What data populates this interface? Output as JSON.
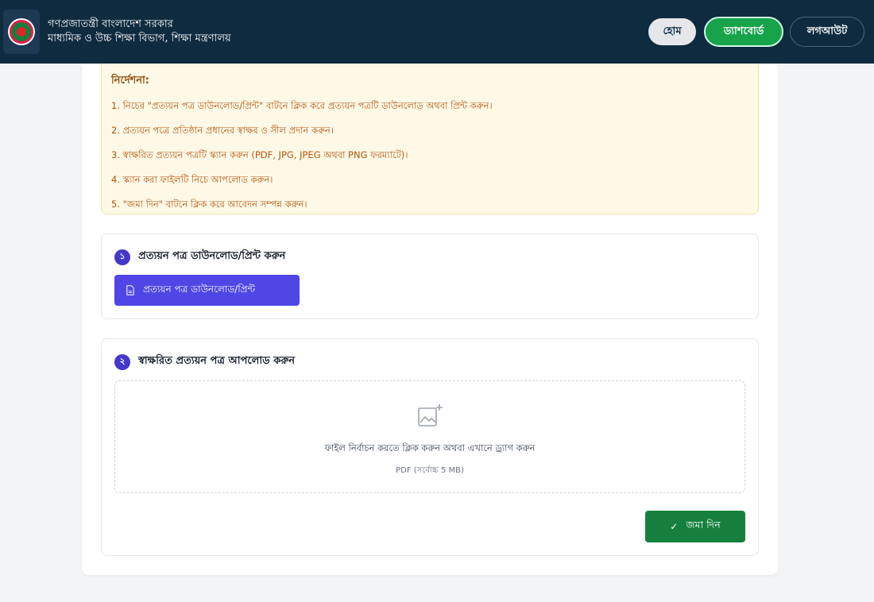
{
  "header": {
    "org_line1": "গণপ্রজাতন্ত্রী বাংলাদেশ সরকার",
    "org_line2": "মাধ্যমিক ও উচ্চ শিক্ষা বিভাগ, শিক্ষা মন্ত্রণালয়",
    "nav": {
      "home": "হোম",
      "dashboard": "ড্যাশবোর্ড",
      "logout": "লগআউট"
    }
  },
  "instructions": {
    "title": "নির্দেশনা:",
    "items": [
      "1. নিচের \"প্রত্যয়ন পত্র ডাউনলোড/প্রিন্ট\" বাটনে ক্লিক করে প্রত্যয়ন পত্রটি ডাউনলোড অথবা প্রিন্ট করুন।",
      "2. প্রত্যয়ন পত্রে প্রতিষ্ঠান প্রধানের স্বাক্ষর ও সীল প্রদান করুন।",
      "3. স্বাক্ষরিত প্রত্যয়ন পত্রটি স্ক্যান করুন (PDF, JPG, JPEG অথবা PNG ফরম্যাটে)।",
      "4. স্ক্যান করা ফাইলটি নিচে আপলোড করুন।",
      "5. \"জমা দিন\" বাটনে ক্লিক করে আবেদন সম্পন্ন করুন।"
    ]
  },
  "step1": {
    "number": "১",
    "title": "প্রত্যয়ন পত্র ডাউনলোড/প্রিন্ট করুন",
    "button": "প্রত্যয়ন পত্র ডাউনলোড/প্রিন্ট"
  },
  "step2": {
    "number": "২",
    "title": "স্বাক্ষরিত প্রত্যয়ন পত্র আপলোড করুন",
    "dropzone_text": "ফাইল নির্বাচন করতে ক্লিক করুন অথবা এখানে ড্র্যাগ করুন",
    "dropzone_sub": "PDF (সর্বোচ্চ 5 MB)",
    "submit": "জমা দিন"
  },
  "colors": {
    "header_bg": "#0f2b40",
    "accent_indigo": "#4f46e5",
    "accent_green": "#15803d",
    "notice_bg": "#fef9e7"
  },
  "icons": {
    "logo": "government-seal-icon",
    "download": "document-icon",
    "upload": "image-add-icon",
    "submit": "check-icon"
  }
}
